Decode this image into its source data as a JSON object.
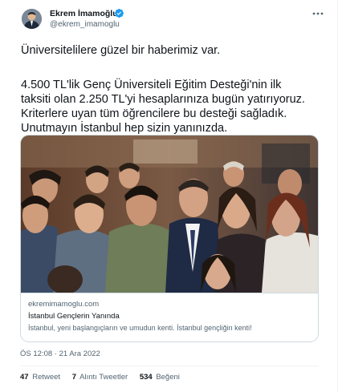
{
  "author": {
    "name": "Ekrem İmamoğlu",
    "handle": "@ekrem_imamoglu",
    "verified_color": "#1d9bf0",
    "avatar_icon": "profile-photo"
  },
  "tweet": {
    "lines": [
      "Üniversitelilere güzel bir haberimiz var.",
      "4.500 TL'lik Genç Üniversiteli Eğitim Desteği'nin ilk",
      "taksiti olan 2.250 TL'yi hesaplarınıza bugün yatırıyoruz.",
      "Kriterlere uyan tüm öğrencilere bu desteği sağladık.",
      "Unutmayın İstanbul hep sizin yanınızda."
    ]
  },
  "card": {
    "domain": "ekremimamoglu.com",
    "title": "İstanbul Gençlerin Yanında",
    "description": "İstanbul, yeni başlangıçların ve umudun kenti. İstanbul gençliğin kenti!"
  },
  "meta": {
    "timestamp": "ÖS 12:08 · 21 Ara 2022",
    "retweets_count": "47",
    "retweets_label": "Retweet",
    "quotes_count": "7",
    "quotes_label": "Alıntı Tweetler",
    "likes_count": "534",
    "likes_label": "Beğeni"
  }
}
